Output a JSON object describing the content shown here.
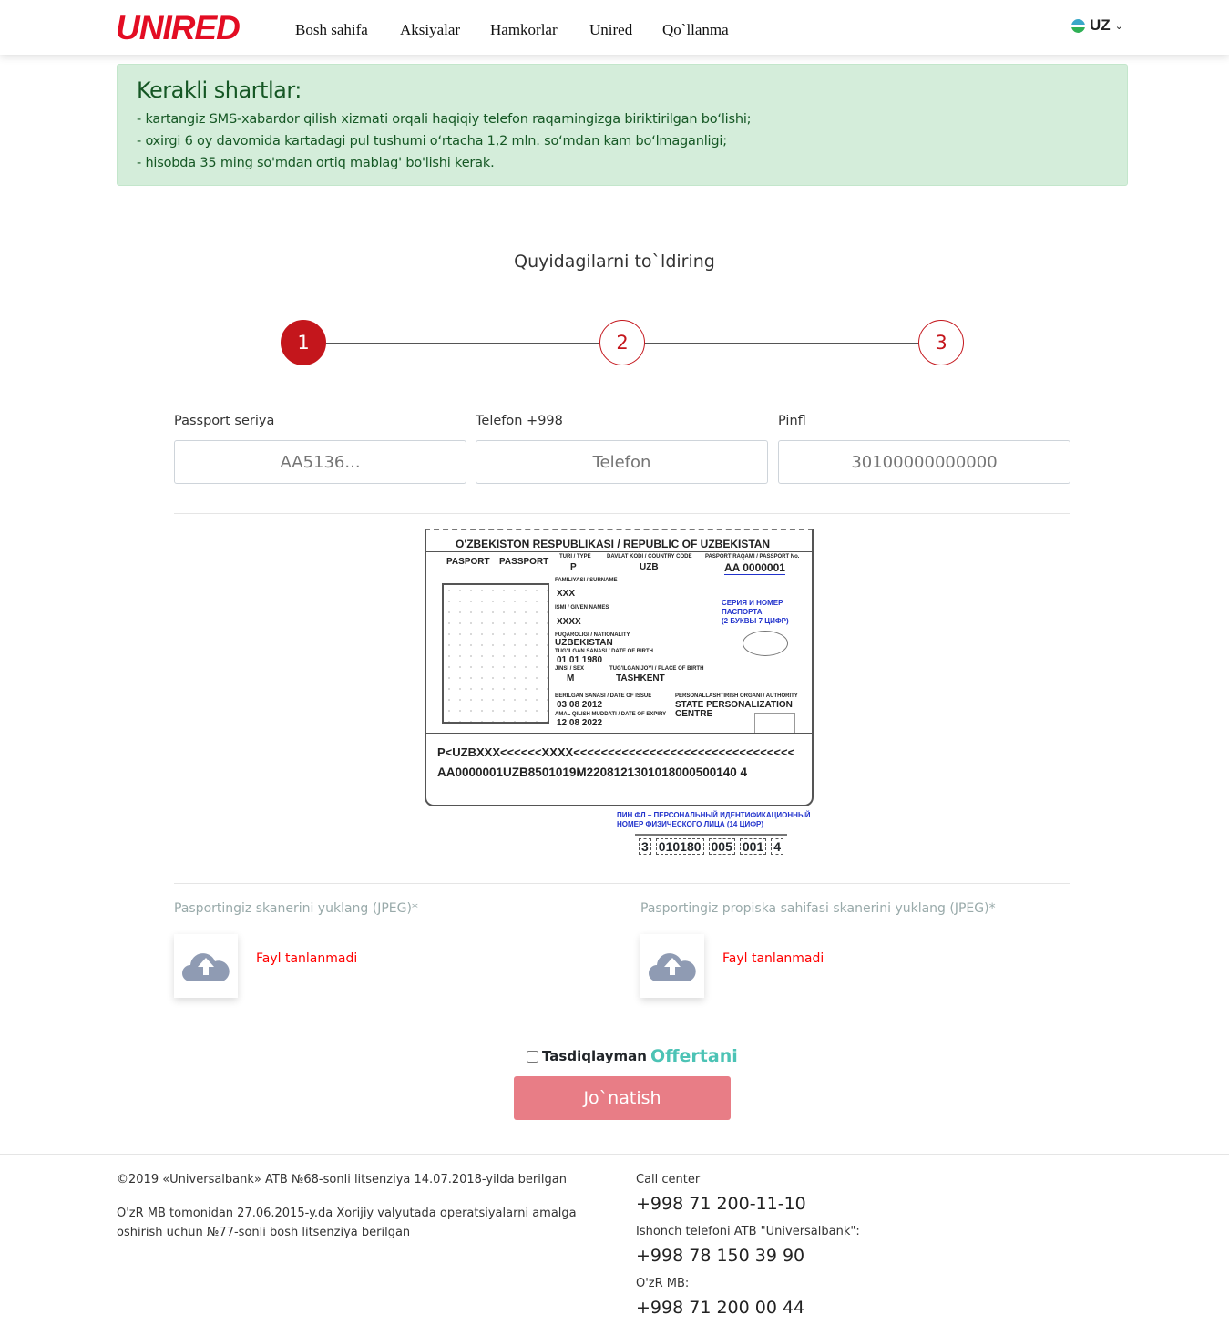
{
  "header": {
    "logo": "UNIRED",
    "nav": [
      "Bosh sahifa",
      "Aksiyalar",
      "Hamkorlar",
      "Unired",
      "Qo`llanma"
    ],
    "lang": "UZ"
  },
  "alert": {
    "title": "Kerakli shartlar:",
    "items": [
      "- kartangiz SMS-xabardor qilish xizmati orqali haqiqiy telefon raqamingizga biriktirilgan bo‘lishi;",
      "- oxirgi 6 oy davomida kartadagi pul tushumi o‘rtacha 1,2 mln. so‘mdan kam bo‘lmaganligi;",
      "- hisobda 35 ming so'mdan ortiq mablag' bo'lishi kerak."
    ]
  },
  "form": {
    "title": "Quyidagilarni to`ldiring",
    "steps": [
      "1",
      "2",
      "3"
    ],
    "active_step": 1,
    "fields": [
      {
        "label": "Passport seriya",
        "placeholder": "AA5136..."
      },
      {
        "label": "Telefon +998",
        "placeholder": "Telefon"
      },
      {
        "label": "Pinfl",
        "placeholder": "30100000000000"
      }
    ],
    "uploads": [
      {
        "label": "Pasportingiz skanerini yuklang (JPEG)*",
        "status": "Fayl tanlanmadi"
      },
      {
        "label": "Pasportingiz propiska sahifasi skanerini yuklang (JPEG)*",
        "status": "Fayl tanlanmadi"
      }
    ],
    "confirm": "Tasdiqlayman",
    "offer_link": "Offertani",
    "submit": "Jo`natish"
  },
  "passport_sample": {
    "header": "O'ZBEKISTON RESPUBLIKASI / REPUBLIC OF UZBEKISTAN",
    "pasport": "PASPORT",
    "passport": "PASSPORT",
    "type_label": "TURI / TYPE",
    "type": "P",
    "country_label": "DAVLAT KODI / COUNTRY CODE",
    "country": "UZB",
    "no_label": "PASPORT RAQAMI / PASSPORT No.",
    "no": "AA 0000001",
    "surname_label": "FAMILIYASI / SURNAME",
    "surname": "XXX",
    "given_label": "ISMI / GIVEN NAMES",
    "given": "XXXX",
    "nat_label": "FUQAROLIGI / NATIONALITY",
    "nat": "UZBEKISTAN",
    "dob_label": "TUG'ILGAN SANASI / DATE OF BIRTH",
    "dob": "01   01   1980",
    "sex_label": "JINSI / SEX",
    "sex": "M",
    "pob_label": "TUG'ILGAN JOYI / PLACE OF BIRTH",
    "pob": "TASHKENT",
    "doi_label": "BERILGAN SANASI / DATE OF ISSUE",
    "doi": "03   08   2012",
    "doe_label": "AMAL QILISH MUDDATI / DATE OF EXPIRY",
    "doe": "12   08   2022",
    "auth_label": "PERSONALLASHTIRISH ORGANI / AUTHORITY",
    "auth1": "STATE PERSONALIZATION",
    "auth2": "CENTRE",
    "note1a": "СЕРИЯ И НОМЕР",
    "note1b": "ПАСПОРТА",
    "note1c": "(2 БУКВЫ 7 ЦИФР)",
    "mrz1": "P<UZBXXX<<<<<<XXXX<<<<<<<<<<<<<<<<<<<<<<<<<<<<<<<<",
    "mrz2": "AA0000001UZB8501019M2208121301018000500140 4",
    "note2a": "ПИН ФЛ – ПЕРСОНАЛЬНЫЙ ИДЕНТИФИКАЦИОННЫЙ",
    "note2b": "НОМЕР ФИЗИЧЕСКОГО ЛИЦА (14 ЦИФР)",
    "pin_parts": [
      "3",
      "010180",
      "005",
      "001",
      "4"
    ]
  },
  "footer": {
    "copyright": "©2019 «Universalbank» ATB №68-sonli litsenziya 14.07.2018-yilda berilgan",
    "license": "O'zR MB tomonidan 27.06.2015-y.da Xorijiy valyutada operatsiyalarni amalga oshirish uchun №77-sonli bosh litsenziya berilgan",
    "contacts": [
      {
        "label": "Call center",
        "phone": "+998 71 200-11-10"
      },
      {
        "label": "Ishonch telefoni ATB \"Universalbank\":",
        "phone": "+998 78 150 39 90"
      },
      {
        "label": "O'zR MB:",
        "phone": "+998 71 200 00 44"
      }
    ]
  },
  "colors": {
    "brand": "#e30d23",
    "step": "#c4161c",
    "alert_bg": "#d4edda",
    "submit": "#e87d86",
    "offer": "#4cc3b5"
  }
}
